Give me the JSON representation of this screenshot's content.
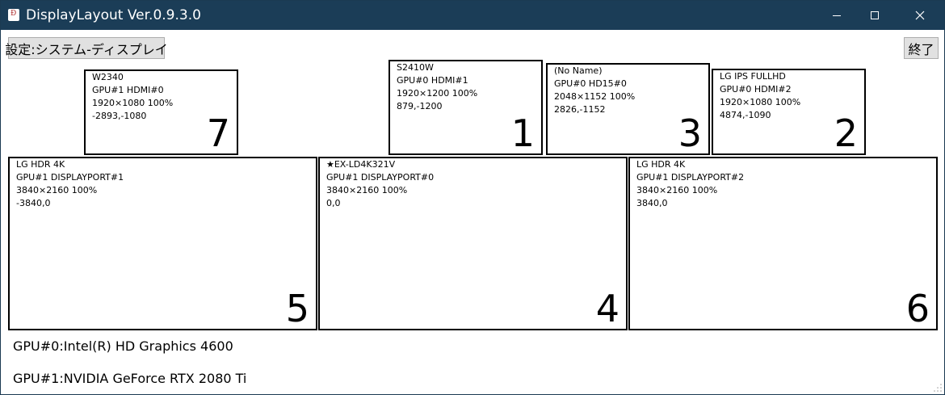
{
  "window": {
    "title": "DisplayLayout Ver.0.9.3.0",
    "icon": "app-icon",
    "icon_glyph": "Ð"
  },
  "toolbar": {
    "settings_label": "設定:システム-ディスプレイ",
    "exit_label": "終了"
  },
  "monitors": [
    {
      "number": "7",
      "name": "W2340",
      "port": "GPU#1 HDMI#0",
      "resolution": "1920×1080 100%",
      "position": "-2893,-1080"
    },
    {
      "number": "1",
      "name": "S2410W",
      "port": "GPU#0 HDMI#1",
      "resolution": "1920×1200 100%",
      "position": "879,-1200"
    },
    {
      "number": "3",
      "name": "(No Name)",
      "port": "GPU#0 HD15#0",
      "resolution": "2048×1152 100%",
      "position": "2826,-1152"
    },
    {
      "number": "2",
      "name": "LG IPS FULLHD",
      "port": "GPU#0 HDMI#2",
      "resolution": "1920×1080 100%",
      "position": "4874,-1090"
    },
    {
      "number": "5",
      "name": "LG HDR 4K",
      "port": "GPU#1 DISPLAYPORT#1",
      "resolution": "3840×2160 100%",
      "position": "-3840,0"
    },
    {
      "number": "4",
      "name": "★EX-LD4K321V",
      "port": "GPU#1 DISPLAYPORT#0",
      "resolution": "3840×2160 100%",
      "position": "0,0"
    },
    {
      "number": "6",
      "name": "LG HDR 4K",
      "port": "GPU#1 DISPLAYPORT#2",
      "resolution": "3840×2160 100%",
      "position": "3840,0"
    }
  ],
  "gpus": [
    "GPU#0:Intel(R) HD Graphics 4600",
    "GPU#1:NVIDIA GeForce RTX 2080 Ti"
  ]
}
